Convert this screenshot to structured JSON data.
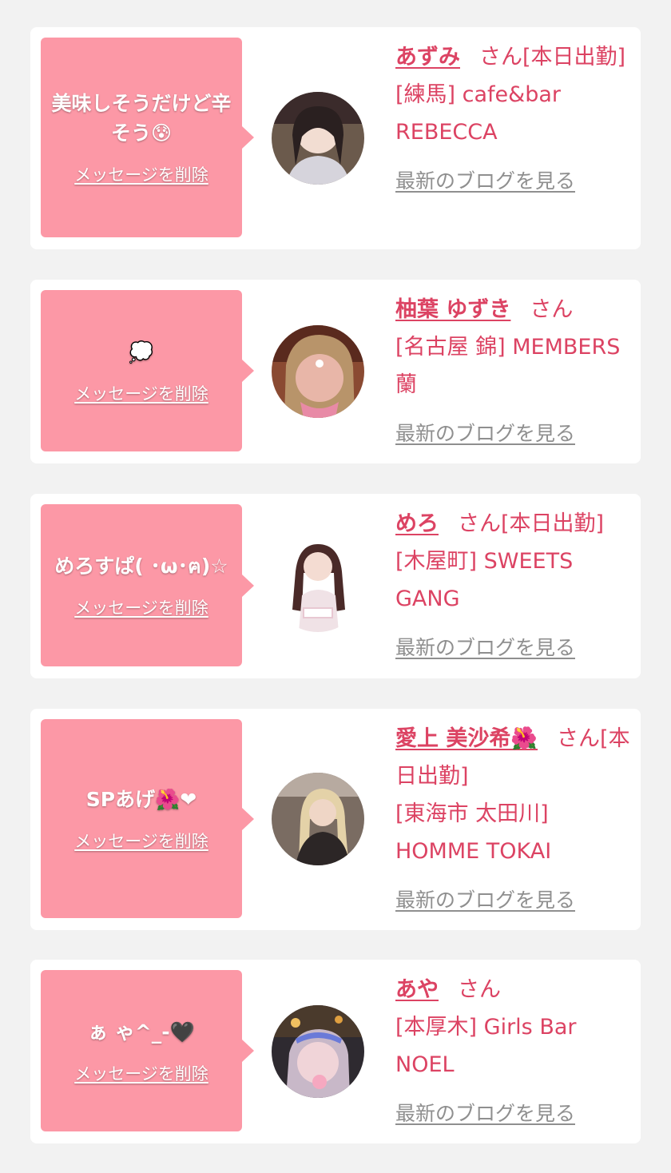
{
  "colors": {
    "page_bg": "#f2f2f2",
    "card_bg": "#ffffff",
    "bubble_bg": "#fc98a6",
    "accent_text": "#dc4363",
    "link_gray": "#8f8f8f"
  },
  "cards": [
    {
      "message": "美味しそうだけど辛そう",
      "message_emoji": "😰",
      "delete_label": "メッセージを削除",
      "name": "あずみ",
      "suffix": "さん[本日出勤]",
      "shop": "[練馬] cafe&bar REBECCA",
      "blog_label": "最新のブログを見る",
      "avatar_icon": "person-photo-icon"
    },
    {
      "message": "",
      "message_emoji": "💭",
      "delete_label": "メッセージを削除",
      "name": "柚葉 ゆずき",
      "suffix": "さん",
      "shop": "[名古屋 錦] MEMBERS 蘭",
      "blog_label": "最新のブログを見る",
      "avatar_icon": "person-photo-icon"
    },
    {
      "message": "めろすぱ( ･ω･ฅ)",
      "message_emoji": "☆",
      "delete_label": "メッセージを削除",
      "name": "めろ",
      "suffix": "さん[本日出勤]",
      "shop": "[木屋町] SWEETS GANG",
      "blog_label": "最新のブログを見る",
      "avatar_icon": "person-photo-icon"
    },
    {
      "message": "SPあげ",
      "message_emoji": "🌺❤",
      "delete_label": "メッセージを削除",
      "name": "愛上 美沙希🌺",
      "suffix": "さん[本日出勤]",
      "shop": "[東海市 太田川] HOMME TOKAI",
      "blog_label": "最新のブログを見る",
      "avatar_icon": "person-photo-icon"
    },
    {
      "message": "ぁ ゃ^_-",
      "message_emoji": "🖤",
      "delete_label": "メッセージを削除",
      "name": "あや",
      "suffix": "さん",
      "shop": "[本厚木] Girls Bar NOEL",
      "blog_label": "最新のブログを見る",
      "avatar_icon": "person-photo-icon"
    }
  ]
}
